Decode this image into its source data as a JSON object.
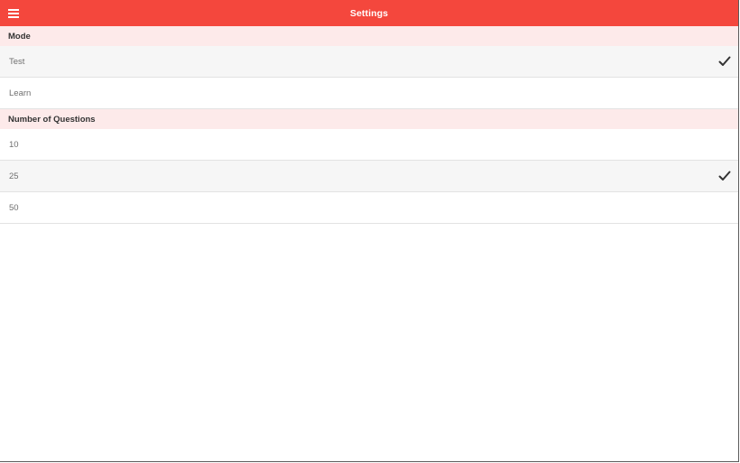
{
  "toolbar": {
    "title": "Settings",
    "menu_icon": "hamburger-menu-icon",
    "background_color": "#f4473d"
  },
  "sections": [
    {
      "header": "Mode",
      "options": [
        {
          "label": "Test",
          "selected": true
        },
        {
          "label": "Learn",
          "selected": false
        }
      ]
    },
    {
      "header": "Number of Questions",
      "options": [
        {
          "label": "10",
          "selected": false
        },
        {
          "label": "25",
          "selected": true
        },
        {
          "label": "50",
          "selected": false
        }
      ]
    }
  ],
  "icons": {
    "selected": "checkmark-icon"
  }
}
